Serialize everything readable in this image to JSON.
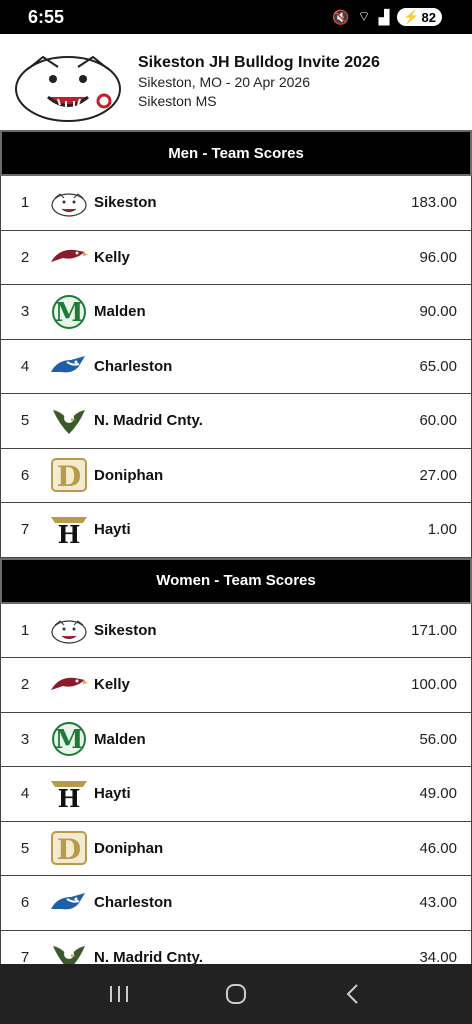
{
  "status": {
    "time": "6:55",
    "battery": "82"
  },
  "header": {
    "title": "Sikeston JH Bulldog Invite 2026",
    "location": "Sikeston, MO - 20 Apr 2026",
    "venue": "Sikeston MS"
  },
  "men": {
    "title": "Men - Team Scores",
    "rows": [
      {
        "rank": "1",
        "team": "Sikeston",
        "score": "183.00",
        "logo": "bulldog"
      },
      {
        "rank": "2",
        "team": "Kelly",
        "score": "96.00",
        "logo": "hawk"
      },
      {
        "rank": "3",
        "team": "Malden",
        "score": "90.00",
        "logo": "m"
      },
      {
        "rank": "4",
        "team": "Charleston",
        "score": "65.00",
        "logo": "bluejay"
      },
      {
        "rank": "5",
        "team": "N. Madrid Cnty.",
        "score": "60.00",
        "logo": "eagle"
      },
      {
        "rank": "6",
        "team": "Doniphan",
        "score": "27.00",
        "logo": "d"
      },
      {
        "rank": "7",
        "team": "Hayti",
        "score": "1.00",
        "logo": "h"
      }
    ]
  },
  "women": {
    "title": "Women - Team Scores",
    "rows": [
      {
        "rank": "1",
        "team": "Sikeston",
        "score": "171.00",
        "logo": "bulldog"
      },
      {
        "rank": "2",
        "team": "Kelly",
        "score": "100.00",
        "logo": "hawk"
      },
      {
        "rank": "3",
        "team": "Malden",
        "score": "56.00",
        "logo": "m"
      },
      {
        "rank": "4",
        "team": "Hayti",
        "score": "49.00",
        "logo": "h"
      },
      {
        "rank": "5",
        "team": "Doniphan",
        "score": "46.00",
        "logo": "d"
      },
      {
        "rank": "6",
        "team": "Charleston",
        "score": "43.00",
        "logo": "bluejay"
      },
      {
        "rank": "7",
        "team": "N. Madrid Cnty.",
        "score": "34.00",
        "logo": "eagle"
      }
    ]
  },
  "colors": {
    "header_bg": "#000000",
    "row_border": "#444444",
    "kelly": "#8b1a2b",
    "malden": "#1f7a3a",
    "charleston": "#1f5fa8",
    "doniphan": "#b89b4a"
  }
}
